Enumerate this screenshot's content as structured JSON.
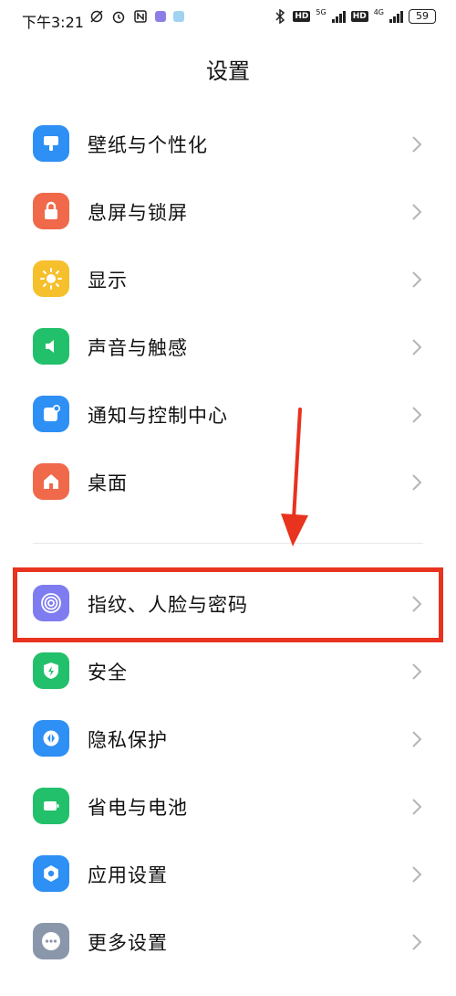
{
  "status_bar": {
    "time": "下午3:21",
    "net1": "5G",
    "net2": "4G",
    "hd1": "HD",
    "hd2": "HD",
    "battery": "59"
  },
  "page_title": "设置",
  "group1": [
    {
      "label": "壁纸与个性化",
      "icon": "wallpaper-icon",
      "color": "#2e8ff5"
    },
    {
      "label": "息屏与锁屏",
      "icon": "lock-icon",
      "color": "#f0694a"
    },
    {
      "label": "显示",
      "icon": "sun-icon",
      "color": "#f6bf2c"
    },
    {
      "label": "声音与触感",
      "icon": "speaker-icon",
      "color": "#22c06a"
    },
    {
      "label": "通知与控制中心",
      "icon": "notification-icon",
      "color": "#2e8ff5"
    },
    {
      "label": "桌面",
      "icon": "home-icon",
      "color": "#f0694a"
    }
  ],
  "group2": [
    {
      "label": "指纹、人脸与密码",
      "icon": "fingerprint-icon",
      "color": "#7e7cf0"
    },
    {
      "label": "安全",
      "icon": "shield-icon",
      "color": "#22c06a"
    },
    {
      "label": "隐私保护",
      "icon": "privacy-icon",
      "color": "#2e8ff5"
    },
    {
      "label": "省电与电池",
      "icon": "battery-icon",
      "color": "#22c06a"
    },
    {
      "label": "应用设置",
      "icon": "gear-icon",
      "color": "#2e8ff5"
    },
    {
      "label": "更多设置",
      "icon": "more-icon",
      "color": "#8a96aa"
    }
  ],
  "annotation_color": "#e8331f"
}
